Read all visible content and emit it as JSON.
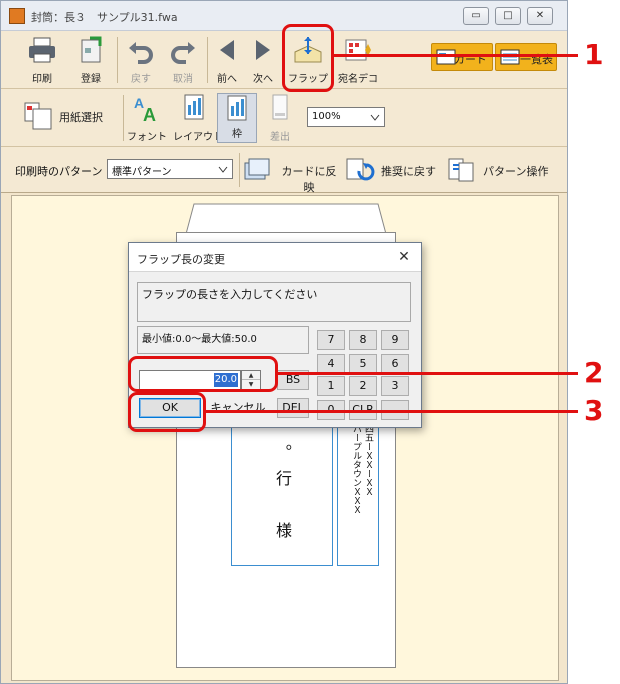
{
  "window": {
    "title": "封筒：長３　サンプル31.fwa",
    "minimize": "▭",
    "maximize": "□",
    "close": "✕"
  },
  "toolbar1": {
    "print": "印刷",
    "register": "登録",
    "back": "戻す",
    "cancel": "取消",
    "prev": "前へ",
    "next": "次へ",
    "flap": "フラップ",
    "address_deco": "宛名デコ",
    "card": "カード",
    "list": "一覧表"
  },
  "toolbar2": {
    "paper_select": "用紙選択",
    "font": "フォント",
    "layout": "レイアウト",
    "frame": "枠",
    "insert": "差出",
    "zoom": "100%"
  },
  "toolbar3": {
    "pattern_label": "印刷時のパターン",
    "pattern_value": "標準パターン",
    "reflect_card": "カードに反映",
    "restore_recommended": "推奨に戻す",
    "pattern_ops": "パターン操作"
  },
  "envelope": {
    "name_chars": "。行　様",
    "address_text": "四五ーＸＸーＸＸ\nパープルタウンＸＸＸ"
  },
  "dialog": {
    "title": "フラップ長の変更",
    "prompt": "フラップの長さを入力してください",
    "range": "最小値:0.0～最大値:50.0",
    "value": "20.0",
    "keys": [
      "7",
      "8",
      "9",
      "4",
      "5",
      "6",
      "1",
      "2",
      "3",
      "0",
      "CLR",
      "."
    ],
    "bs": "BS",
    "del": "DEL",
    "ok": "OK",
    "cancel": "キャンセル"
  },
  "callouts": [
    "1",
    "2",
    "3"
  ],
  "colors": {
    "highlight": "#e01010",
    "accent": "#2f6fd0",
    "ribbon": "#f4e9d3"
  }
}
